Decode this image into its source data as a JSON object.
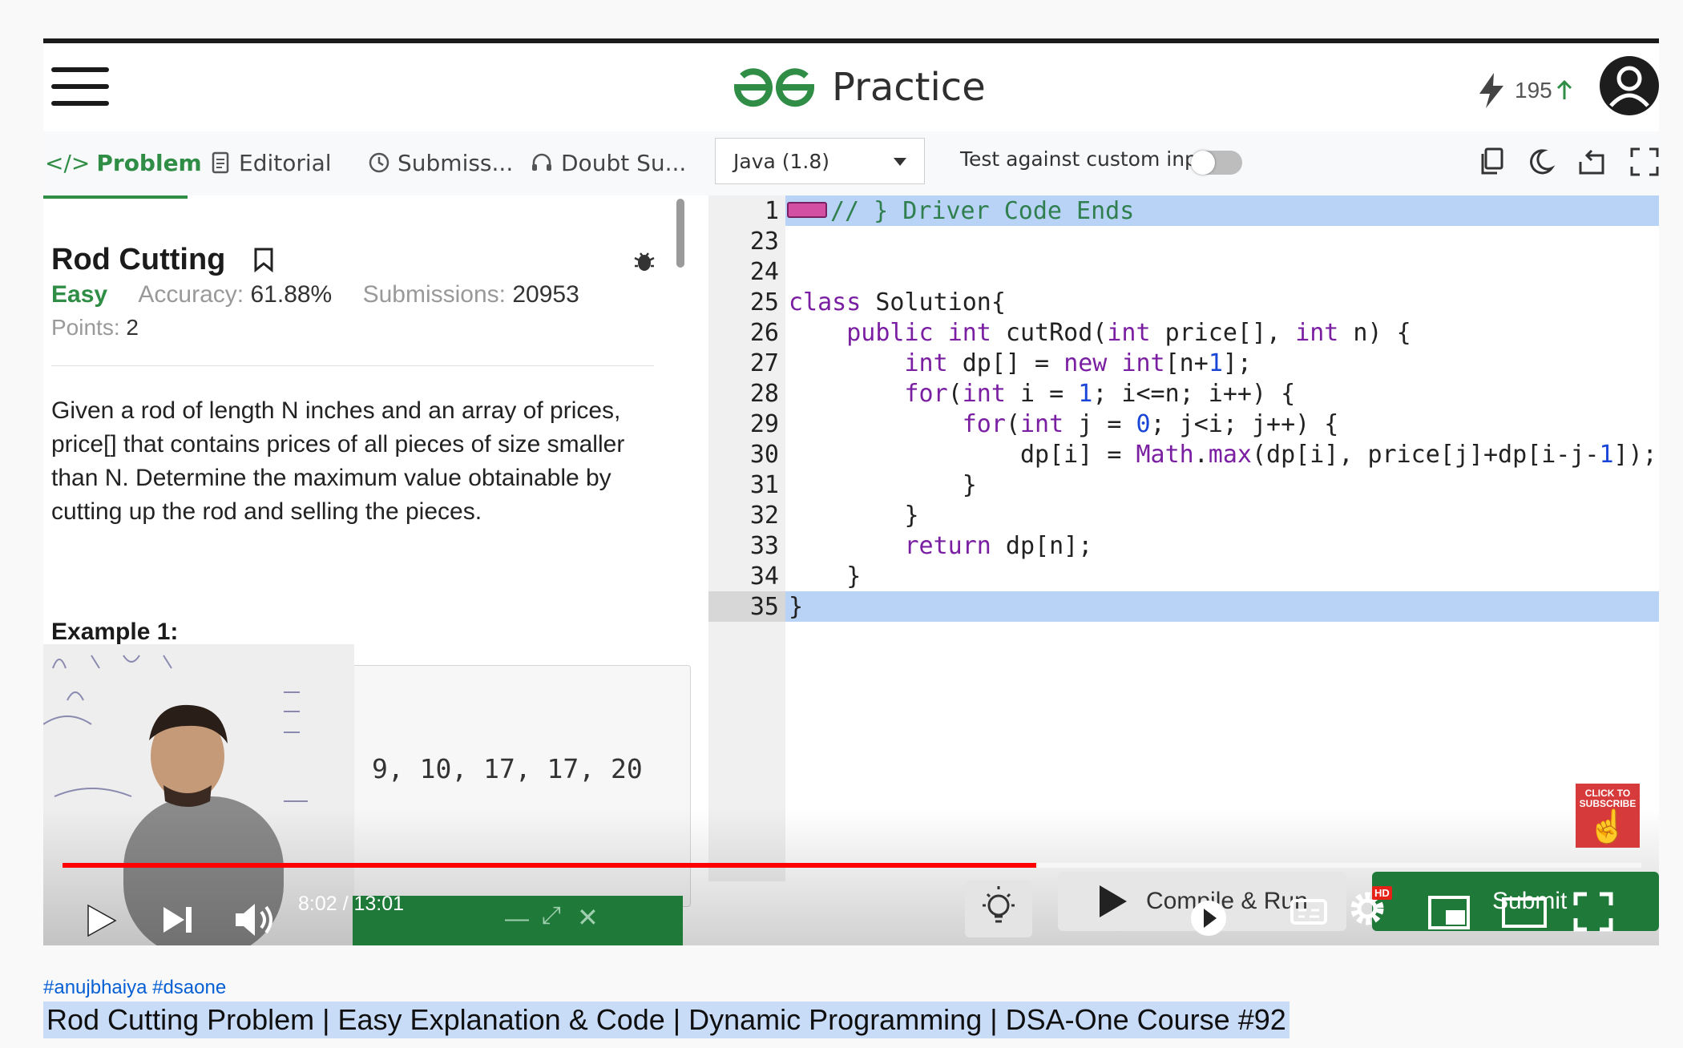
{
  "app": {
    "logo_text": "Practice",
    "streak_count": "195"
  },
  "tabs": [
    {
      "label": "Problem"
    },
    {
      "label": "Editorial"
    },
    {
      "label": "Submiss..."
    },
    {
      "label": "Doubt Su..."
    }
  ],
  "editor_toolbar": {
    "language": "Java (1.8)",
    "custom_input_label": "Test against custom input",
    "custom_input_enabled": false
  },
  "problem": {
    "title": "Rod Cutting",
    "difficulty": "Easy",
    "accuracy_label": "Accuracy:",
    "accuracy_value": "61.88%",
    "submissions_label": "Submissions:",
    "submissions_value": "20953",
    "points_label": "Points:",
    "points_value": "2",
    "description": "Given a rod of length N inches and an array of prices, price[] that contains prices of all pieces of size smaller than N. Determine the maximum value obtainable by cutting up the rod and selling the pieces.",
    "example_heading": "Example 1:",
    "example_values": "9, 10, 17, 17, 20"
  },
  "code_lines": [
    {
      "n": "1",
      "text": "// } Driver Code Ends"
    },
    {
      "n": "23",
      "text": ""
    },
    {
      "n": "24",
      "text": ""
    },
    {
      "n": "25",
      "text": "class Solution{"
    },
    {
      "n": "26",
      "text": "    public int cutRod(int price[], int n) {"
    },
    {
      "n": "27",
      "text": "        int dp[] = new int[n+1];"
    },
    {
      "n": "28",
      "text": "        for(int i = 1; i<=n; i++) {"
    },
    {
      "n": "29",
      "text": "            for(int j = 0; j<i; j++) {"
    },
    {
      "n": "30",
      "text": "                dp[i] = Math.max(dp[i], price[j]+dp[i-j-1]);"
    },
    {
      "n": "31",
      "text": "            }"
    },
    {
      "n": "32",
      "text": "        }"
    },
    {
      "n": "33",
      "text": "        return dp[n];"
    },
    {
      "n": "34",
      "text": "    }"
    },
    {
      "n": "35",
      "text": "}"
    }
  ],
  "editor_actions": {
    "run_label": "Compile & Run",
    "submit_label": "Submit"
  },
  "player": {
    "current_time": "8:02",
    "duration": "13:01",
    "time_display": "8:02 / 13:01",
    "progress": 0.617,
    "subscribe_label": "CLICK TO SUBSCRIBE",
    "hd_badge": "HD"
  },
  "video_info": {
    "hashtags": "#anujbhaiya #dsaone",
    "title": "Rod Cutting Problem | Easy Explanation & Code | Dynamic Programming | DSA-One Course #92"
  },
  "colors": {
    "gfg_green": "#2f8d46",
    "progress_red": "#ff0000",
    "selection_blue": "#b8d3f6",
    "link_blue": "#065fd4"
  }
}
